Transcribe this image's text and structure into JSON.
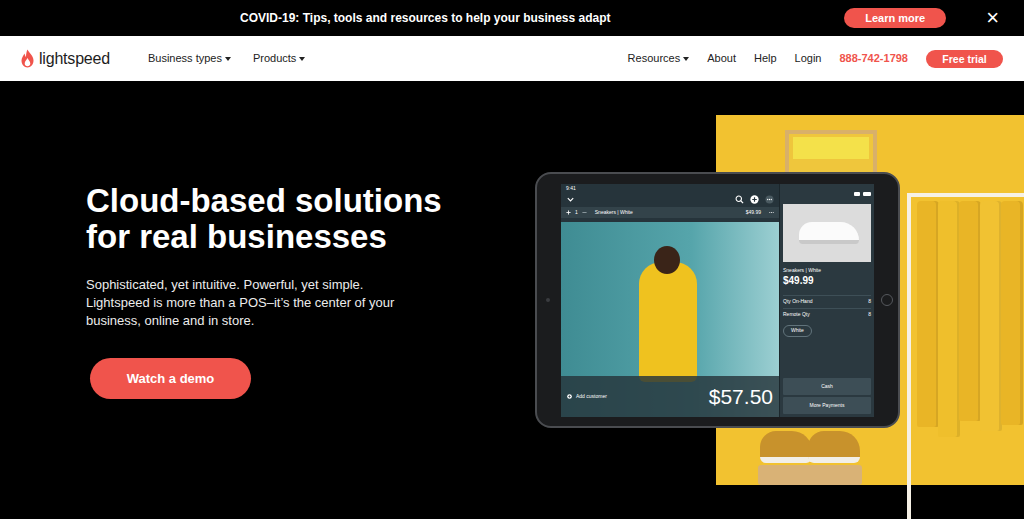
{
  "banner": {
    "text": "COVID-19: Tips, tools and resources to help your business adapt",
    "button": "Learn more",
    "close": "×"
  },
  "navbar": {
    "logo": "lightspeed",
    "left_items": [
      {
        "label": "Business types",
        "dropdown": true
      },
      {
        "label": "Products",
        "dropdown": true
      }
    ],
    "right_items": [
      {
        "label": "Resources",
        "dropdown": true
      },
      {
        "label": "About",
        "dropdown": false
      },
      {
        "label": "Help",
        "dropdown": false
      },
      {
        "label": "Login",
        "dropdown": false
      }
    ],
    "phone": "888-742-1798",
    "cta": "Free trial"
  },
  "hero": {
    "title_lines": [
      "Cloud-based solutions",
      "for real businesses"
    ],
    "description_lines": [
      "Sophisticated, yet intuitive. Powerful, yet simple.",
      "Lightspeed is more than a POS–it’s the center of your",
      "business, online and in store."
    ],
    "button": "Watch a demo"
  },
  "pos": {
    "time": "9:41",
    "line_item": {
      "qty": "1",
      "name": "Sneakers | White",
      "price": "$49.99"
    },
    "product": {
      "name": "Sneakers | White",
      "price": "$49.99",
      "stock": [
        {
          "label": "Qty On-Hand",
          "value": "8"
        },
        {
          "label": "Remote Qty",
          "value": "8"
        }
      ],
      "variant": "White"
    },
    "add_customer": "Add customer",
    "total": "$57.50",
    "payments": [
      "Cash",
      "More Payments"
    ]
  }
}
